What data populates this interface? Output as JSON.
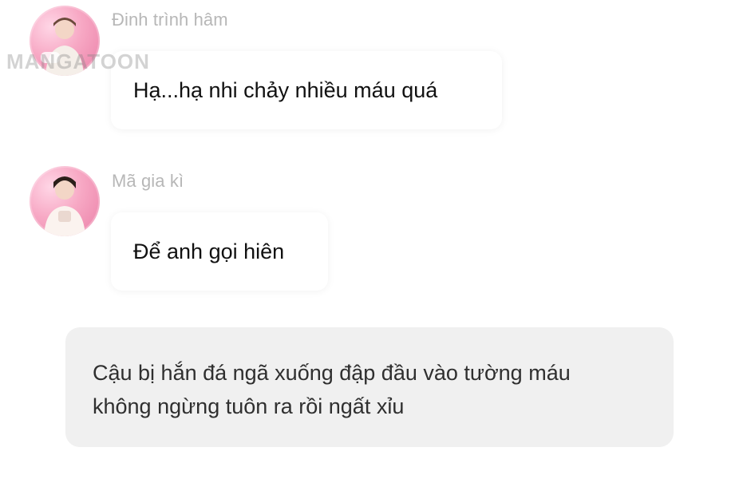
{
  "watermark": "MANGATOON",
  "messages": [
    {
      "sender": "Đinh trình hâm",
      "text": "Hạ...hạ nhi chảy nhiều máu quá"
    },
    {
      "sender": "Mã gia kì",
      "text": "Để anh gọi hiên"
    }
  ],
  "narration": {
    "line1": "Cậu bị hắn đá ngã xuống đập đầu vào tường máu",
    "line2": "không ngừng tuôn ra rồi ngất xỉu"
  },
  "colors": {
    "background": "#ffffff",
    "sender_name": "#b7b7b7",
    "bubble": "#ffffff",
    "narration_bg": "#f0f0f0",
    "avatar_bg": "#f7a8c4"
  }
}
